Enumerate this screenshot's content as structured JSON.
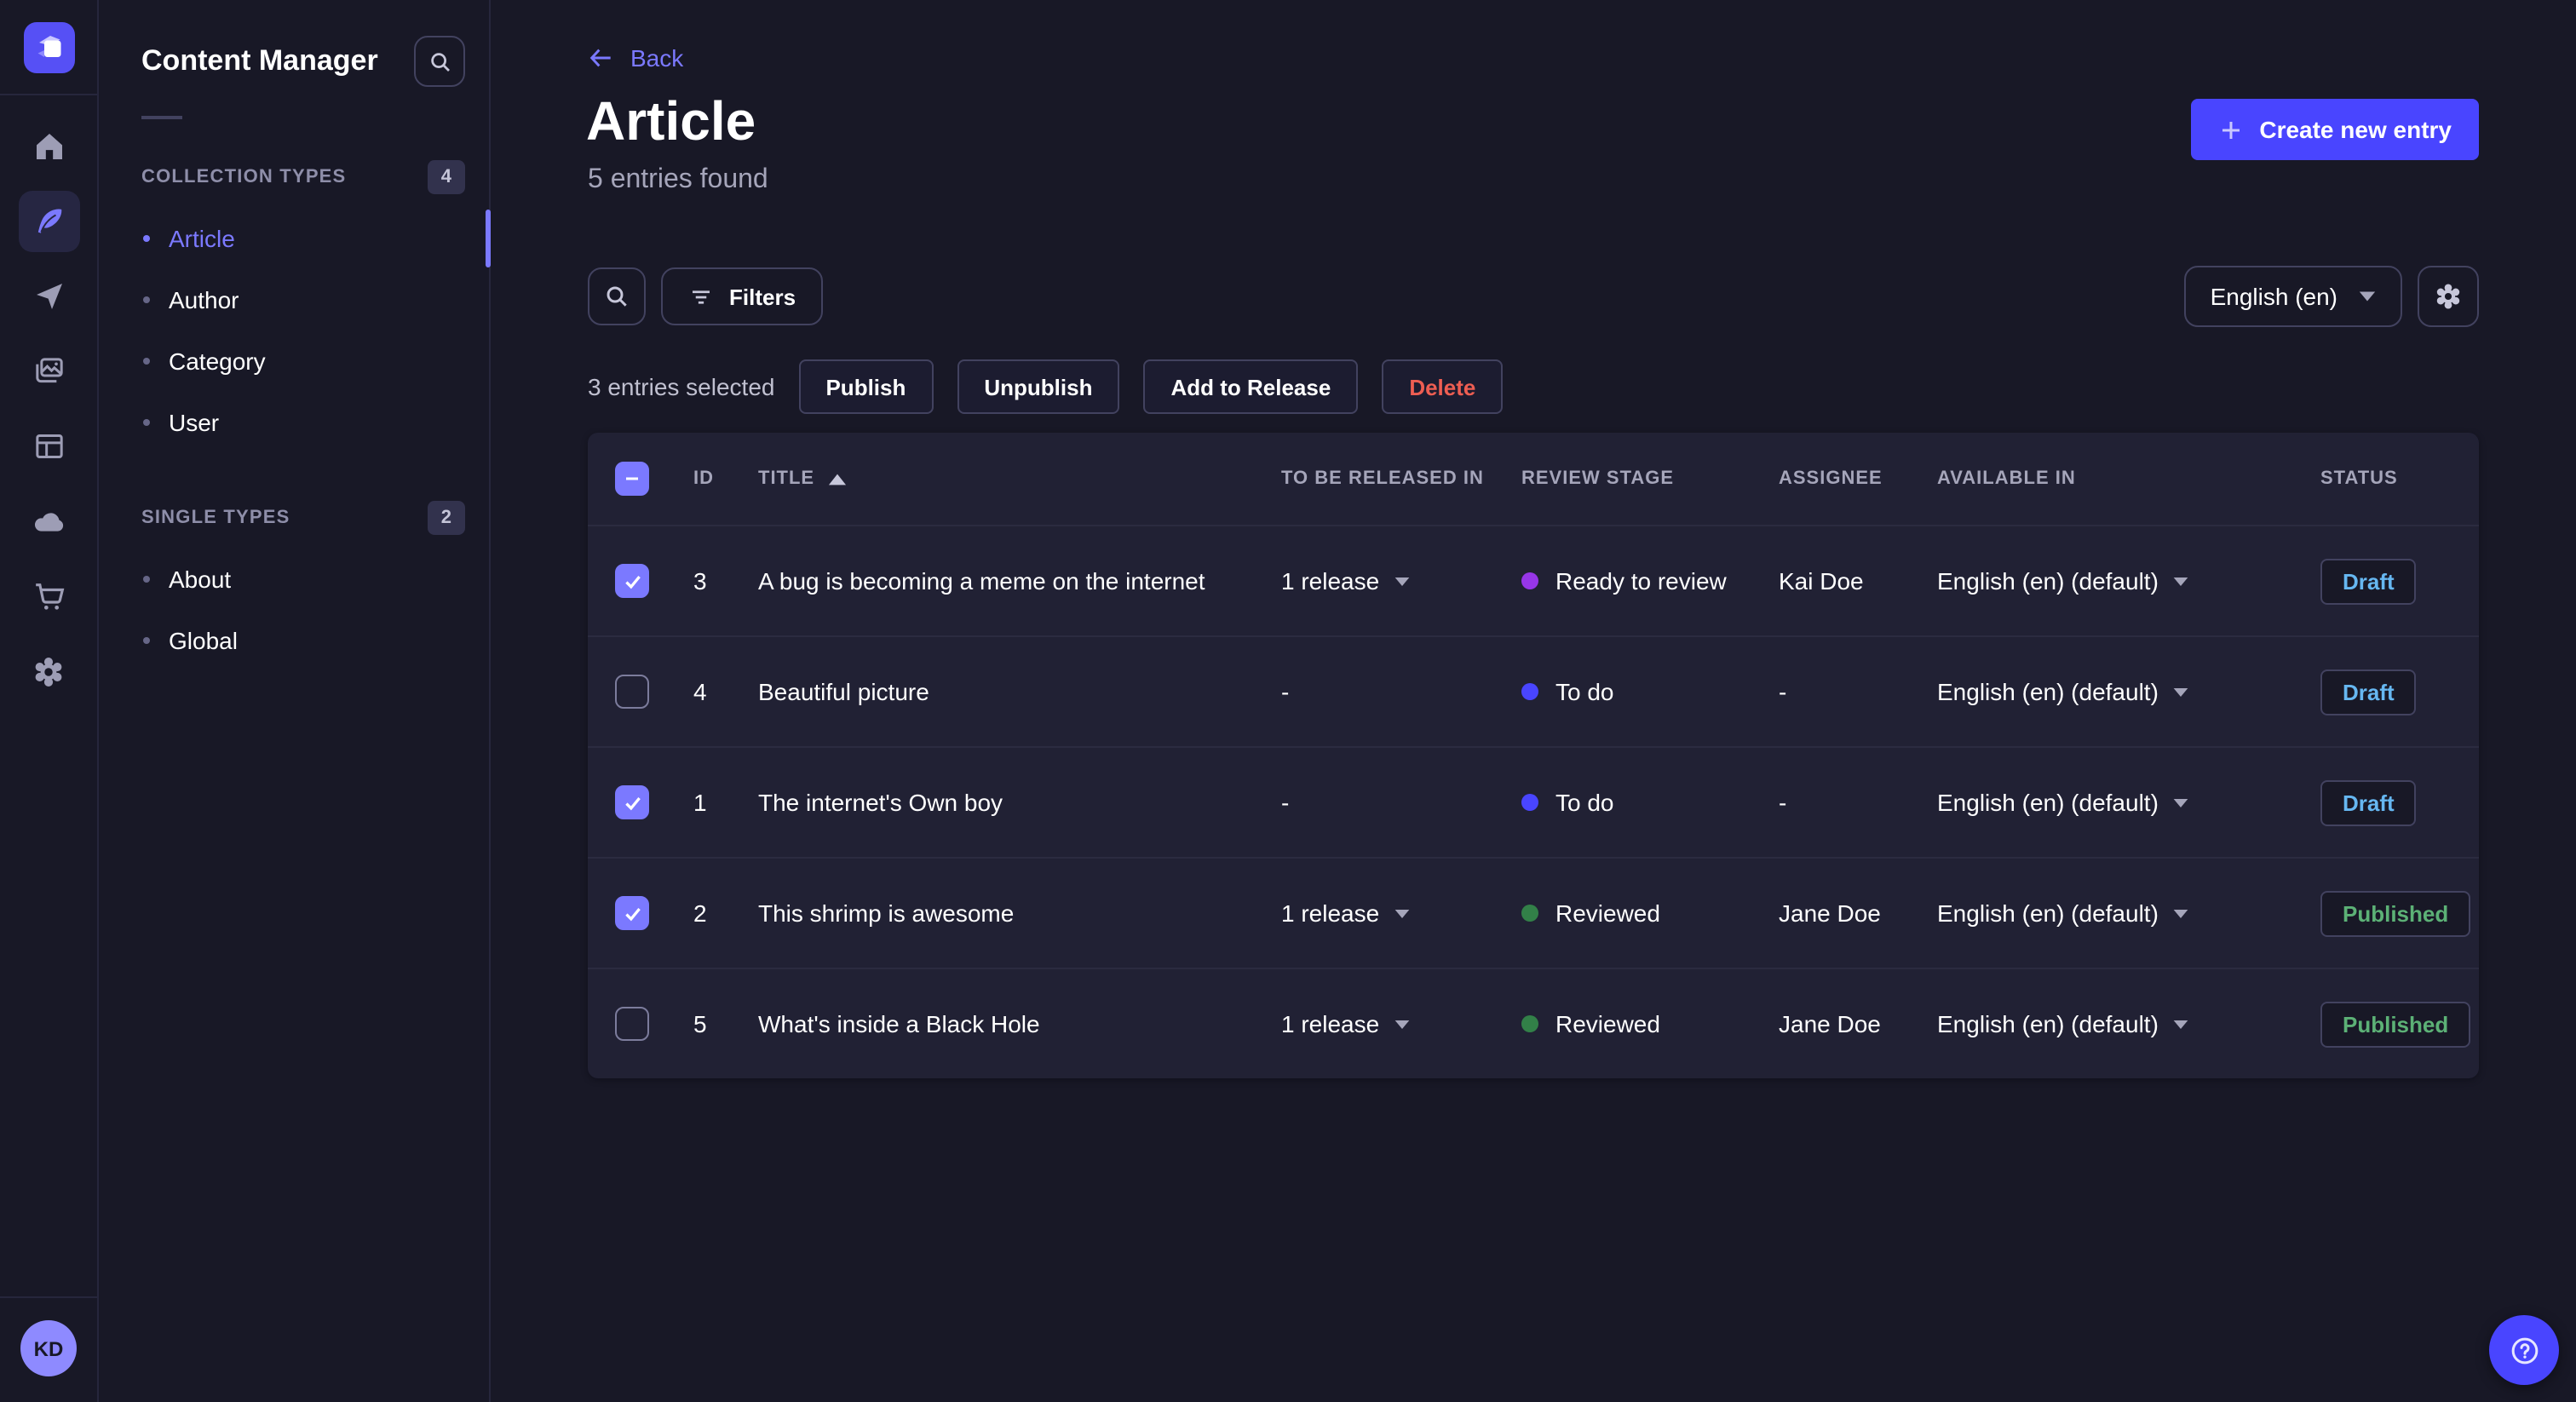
{
  "nav_rail": {
    "icons": [
      "home",
      "content-manager",
      "releases",
      "media-library",
      "content-type-builder",
      "deploy",
      "marketplace",
      "settings"
    ],
    "active_icon": "content-manager",
    "avatar_initials": "KD"
  },
  "subnav": {
    "title": "Content Manager",
    "sections": [
      {
        "label": "COLLECTION TYPES",
        "count": "4",
        "items": [
          {
            "label": "Article",
            "active": true
          },
          {
            "label": "Author",
            "active": false
          },
          {
            "label": "Category",
            "active": false
          },
          {
            "label": "User",
            "active": false
          }
        ]
      },
      {
        "label": "SINGLE TYPES",
        "count": "2",
        "items": [
          {
            "label": "About",
            "active": false
          },
          {
            "label": "Global",
            "active": false
          }
        ]
      }
    ]
  },
  "header": {
    "back": "Back",
    "title": "Article",
    "subtitle": "5 entries found",
    "create": "Create new entry"
  },
  "toolbar": {
    "filters": "Filters",
    "locale": "English (en)"
  },
  "selection": {
    "text": "3 entries selected",
    "publish": "Publish",
    "unpublish": "Unpublish",
    "add_to_release": "Add to Release",
    "delete": "Delete"
  },
  "table": {
    "headers": {
      "id": "ID",
      "title": "TITLE",
      "release": "TO BE RELEASED IN",
      "stage": "REVIEW STAGE",
      "assignee": "ASSIGNEE",
      "available": "AVAILABLE IN",
      "status": "STATUS"
    },
    "sort": {
      "column": "TITLE",
      "direction": "ascending"
    },
    "header_checkbox_state": "indeterminate",
    "rows": [
      {
        "selected": true,
        "id": "3",
        "title": "A bug is becoming a meme on the internet",
        "to_be_released_in": "1 release",
        "review_stage": "Ready to review",
        "stage_color": "#9736e8",
        "assignee": "Kai Doe",
        "available_in": "English (en) (default)",
        "status": "Draft"
      },
      {
        "selected": false,
        "id": "4",
        "title": "Beautiful picture",
        "to_be_released_in": "-",
        "review_stage": "To do",
        "stage_color": "#4945ff",
        "assignee": "-",
        "available_in": "English (en) (default)",
        "status": "Draft"
      },
      {
        "selected": true,
        "id": "1",
        "title": "The internet's Own boy",
        "to_be_released_in": "-",
        "review_stage": "To do",
        "stage_color": "#4945ff",
        "assignee": "-",
        "available_in": "English (en) (default)",
        "status": "Draft"
      },
      {
        "selected": true,
        "id": "2",
        "title": "This shrimp is awesome",
        "to_be_released_in": "1 release",
        "review_stage": "Reviewed",
        "stage_color": "#328048",
        "assignee": "Jane Doe",
        "available_in": "English (en) (default)",
        "status": "Published"
      },
      {
        "selected": false,
        "id": "5",
        "title": "What's inside a Black Hole",
        "to_be_released_in": "1 release",
        "review_stage": "Reviewed",
        "stage_color": "#328048",
        "assignee": "Jane Doe",
        "available_in": "English (en) (default)",
        "status": "Published"
      }
    ]
  },
  "colors": {
    "background": "#181826",
    "surface": "#212134",
    "primary": "#4945ff",
    "primary_light": "#7b79ff",
    "danger": "#ee5e52",
    "status_draft": "#66b7f1",
    "status_published": "#5cb176",
    "stage_todo": "#4945ff",
    "stage_ready_to_review": "#9736e8",
    "stage_reviewed": "#328048"
  }
}
